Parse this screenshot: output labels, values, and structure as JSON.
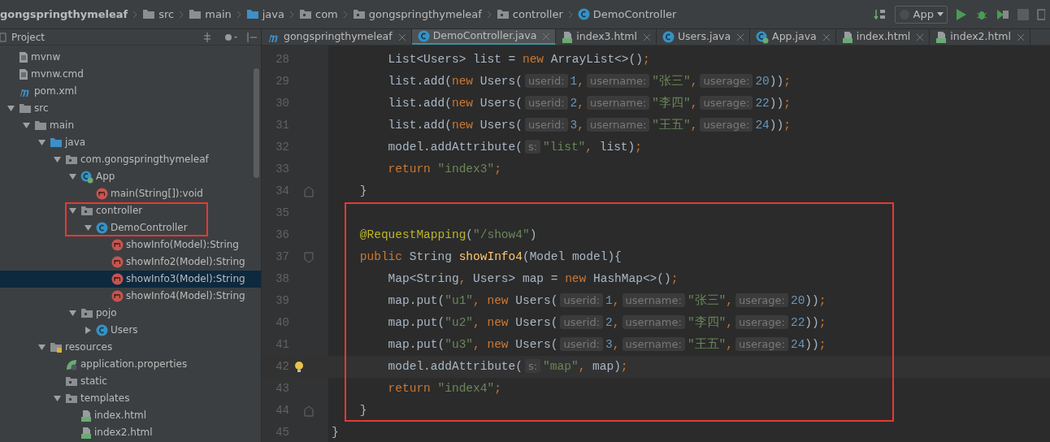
{
  "breadcrumb": [
    {
      "label": "gongspringthymeleaf"
    },
    {
      "label": "src",
      "kind": "folder"
    },
    {
      "label": "main",
      "kind": "folder"
    },
    {
      "label": "java",
      "kind": "source-folder"
    },
    {
      "label": "com",
      "kind": "package"
    },
    {
      "label": "gongspringthymeleaf",
      "kind": "package"
    },
    {
      "label": "controller",
      "kind": "package"
    },
    {
      "label": "DemoController",
      "kind": "class"
    }
  ],
  "run_config": {
    "label": "App"
  },
  "project_panel": {
    "title": "Project"
  },
  "tabs": [
    {
      "label": "gongspringthymeleaf",
      "kind": "maven",
      "selected": false
    },
    {
      "label": "DemoController.java",
      "kind": "class",
      "selected": true
    },
    {
      "label": "index3.html",
      "kind": "html",
      "selected": false
    },
    {
      "label": "Users.java",
      "kind": "class",
      "selected": false
    },
    {
      "label": "App.java",
      "kind": "app-class",
      "selected": false
    },
    {
      "label": "index.html",
      "kind": "html",
      "selected": false
    },
    {
      "label": "index2.html",
      "kind": "html",
      "selected": false
    }
  ],
  "tree": [
    {
      "label": "mvnw",
      "kind": "file",
      "selected": false
    },
    {
      "label": "mvnw.cmd",
      "kind": "file",
      "selected": false
    },
    {
      "label": "pom.xml",
      "kind": "maven",
      "selected": false
    },
    {
      "label": "src",
      "kind": "folder",
      "selected": false,
      "expanded": true,
      "children": [
        {
          "label": "main",
          "kind": "folder",
          "selected": false,
          "expanded": true,
          "children": [
            {
              "label": "java",
              "kind": "source-folder",
              "selected": false,
              "expanded": true,
              "children": [
                {
                  "label": "com.gongspringthymeleaf",
                  "kind": "package",
                  "selected": false,
                  "expanded": true,
                  "children": [
                    {
                      "label": "App",
                      "kind": "app-class",
                      "selected": false,
                      "expanded": true,
                      "children": [
                        {
                          "label": "main(String[]):void",
                          "kind": "method",
                          "selected": false
                        }
                      ]
                    },
                    {
                      "label": "controller",
                      "kind": "package",
                      "selected": false,
                      "expanded": true,
                      "outlined": true,
                      "children": [
                        {
                          "label": "DemoController",
                          "kind": "class",
                          "selected": false,
                          "expanded": true,
                          "outlined": true,
                          "children": [
                            {
                              "label": "showInfo(Model):String",
                              "kind": "method",
                              "selected": false
                            },
                            {
                              "label": "showInfo2(Model):String",
                              "kind": "method",
                              "selected": false
                            },
                            {
                              "label": "showInfo3(Model):String",
                              "kind": "method",
                              "selected": true
                            },
                            {
                              "label": "showInfo4(Model):String",
                              "kind": "method",
                              "selected": false
                            }
                          ]
                        }
                      ]
                    },
                    {
                      "label": "pojo",
                      "kind": "package",
                      "selected": false,
                      "expanded": true,
                      "children": [
                        {
                          "label": "Users",
                          "kind": "class",
                          "selected": false,
                          "expanded": false
                        }
                      ]
                    }
                  ]
                }
              ]
            },
            {
              "label": "resources",
              "kind": "resources-folder",
              "selected": false,
              "expanded": true,
              "children": [
                {
                  "label": "application.properties",
                  "kind": "properties",
                  "selected": false
                },
                {
                  "label": "static",
                  "kind": "package",
                  "selected": false
                },
                {
                  "label": "templates",
                  "kind": "package",
                  "selected": false,
                  "expanded": true,
                  "children": [
                    {
                      "label": "index.html",
                      "kind": "html",
                      "selected": false
                    },
                    {
                      "label": "index2.html",
                      "kind": "html",
                      "selected": false
                    }
                  ]
                }
              ]
            }
          ]
        }
      ]
    }
  ],
  "code": [
    {
      "number": "28",
      "outlined": false,
      "current": false,
      "tokens": [
        {
          "kind": "plain",
          "text": "        List<Users> list = "
        },
        {
          "kind": "keyword",
          "text": "new"
        },
        {
          "kind": "plain",
          "text": " ArrayList<>()"
        },
        {
          "kind": "keyword",
          "text": ";"
        }
      ]
    },
    {
      "number": "29",
      "outlined": false,
      "current": false,
      "tokens": [
        {
          "kind": "plain",
          "text": "        list.add("
        },
        {
          "kind": "keyword",
          "text": "new"
        },
        {
          "kind": "plain",
          "text": " Users("
        },
        {
          "kind": "hint",
          "text": "userid:"
        },
        {
          "kind": "number",
          "text": "1"
        },
        {
          "kind": "keyword",
          "text": ","
        },
        {
          "kind": "hint",
          "text": "username:"
        },
        {
          "kind": "string",
          "text": "\"张三\""
        },
        {
          "kind": "keyword",
          "text": ","
        },
        {
          "kind": "hint",
          "text": "userage:"
        },
        {
          "kind": "number",
          "text": "20"
        },
        {
          "kind": "plain",
          "text": "))"
        },
        {
          "kind": "keyword",
          "text": ";"
        }
      ]
    },
    {
      "number": "30",
      "outlined": false,
      "current": false,
      "tokens": [
        {
          "kind": "plain",
          "text": "        list.add("
        },
        {
          "kind": "keyword",
          "text": "new"
        },
        {
          "kind": "plain",
          "text": " Users("
        },
        {
          "kind": "hint",
          "text": "userid:"
        },
        {
          "kind": "number",
          "text": "2"
        },
        {
          "kind": "keyword",
          "text": ","
        },
        {
          "kind": "hint",
          "text": "username:"
        },
        {
          "kind": "string",
          "text": "\"李四\""
        },
        {
          "kind": "keyword",
          "text": ","
        },
        {
          "kind": "hint",
          "text": "userage:"
        },
        {
          "kind": "number",
          "text": "22"
        },
        {
          "kind": "plain",
          "text": "))"
        },
        {
          "kind": "keyword",
          "text": ";"
        }
      ]
    },
    {
      "number": "31",
      "outlined": false,
      "current": false,
      "tokens": [
        {
          "kind": "plain",
          "text": "        list.add("
        },
        {
          "kind": "keyword",
          "text": "new"
        },
        {
          "kind": "plain",
          "text": " Users("
        },
        {
          "kind": "hint",
          "text": "userid:"
        },
        {
          "kind": "number",
          "text": "3"
        },
        {
          "kind": "keyword",
          "text": ","
        },
        {
          "kind": "hint",
          "text": "username:"
        },
        {
          "kind": "string",
          "text": "\"王五\""
        },
        {
          "kind": "keyword",
          "text": ","
        },
        {
          "kind": "hint",
          "text": "userage:"
        },
        {
          "kind": "number",
          "text": "24"
        },
        {
          "kind": "plain",
          "text": "))"
        },
        {
          "kind": "keyword",
          "text": ";"
        }
      ]
    },
    {
      "number": "32",
      "outlined": false,
      "current": false,
      "tokens": [
        {
          "kind": "plain",
          "text": "        model.addAttribute("
        },
        {
          "kind": "hint",
          "text": "s:"
        },
        {
          "kind": "string",
          "text": "\"list\""
        },
        {
          "kind": "keyword",
          "text": ","
        },
        {
          "kind": "plain",
          "text": " list)"
        },
        {
          "kind": "keyword",
          "text": ";"
        }
      ]
    },
    {
      "number": "33",
      "outlined": false,
      "current": false,
      "tokens": [
        {
          "kind": "keyword",
          "text": "        return"
        },
        {
          "kind": "string",
          "text": " \"index3\""
        },
        {
          "kind": "keyword",
          "text": ";"
        }
      ]
    },
    {
      "number": "34",
      "outlined": false,
      "current": false,
      "tokens": [
        {
          "kind": "plain",
          "text": "    }"
        }
      ]
    },
    {
      "number": "35",
      "outlined": true,
      "current": false
    },
    {
      "number": "36",
      "outlined": true,
      "current": false,
      "tokens": [
        {
          "kind": "annotation",
          "text": "    @RequestMapping"
        },
        {
          "kind": "plain",
          "text": "("
        },
        {
          "kind": "string",
          "text": "\"/show4\""
        },
        {
          "kind": "plain",
          "text": ")"
        }
      ]
    },
    {
      "number": "37",
      "outlined": true,
      "current": false,
      "tokens": [
        {
          "kind": "keyword",
          "text": "    public"
        },
        {
          "kind": "plain",
          "text": " String "
        },
        {
          "kind": "method",
          "text": "showInfo4"
        },
        {
          "kind": "plain",
          "text": "(Model model){"
        }
      ]
    },
    {
      "number": "38",
      "outlined": true,
      "current": false,
      "tokens": [
        {
          "kind": "plain",
          "text": "        Map<String"
        },
        {
          "kind": "keyword",
          "text": ","
        },
        {
          "kind": "plain",
          "text": " Users> map = "
        },
        {
          "kind": "keyword",
          "text": "new"
        },
        {
          "kind": "plain",
          "text": " HashMap<>()"
        },
        {
          "kind": "keyword",
          "text": ";"
        }
      ]
    },
    {
      "number": "39",
      "outlined": true,
      "current": false,
      "tokens": [
        {
          "kind": "plain",
          "text": "        map.put("
        },
        {
          "kind": "string",
          "text": "\"u1\""
        },
        {
          "kind": "keyword",
          "text": ", new"
        },
        {
          "kind": "plain",
          "text": " Users("
        },
        {
          "kind": "hint",
          "text": "userid:"
        },
        {
          "kind": "number",
          "text": "1"
        },
        {
          "kind": "keyword",
          "text": ","
        },
        {
          "kind": "hint",
          "text": "username:"
        },
        {
          "kind": "string",
          "text": "\"张三\""
        },
        {
          "kind": "keyword",
          "text": ","
        },
        {
          "kind": "hint",
          "text": "userage:"
        },
        {
          "kind": "number",
          "text": "20"
        },
        {
          "kind": "plain",
          "text": "))"
        },
        {
          "kind": "keyword",
          "text": ";"
        }
      ]
    },
    {
      "number": "40",
      "outlined": true,
      "current": false,
      "tokens": [
        {
          "kind": "plain",
          "text": "        map.put("
        },
        {
          "kind": "string",
          "text": "\"u2\""
        },
        {
          "kind": "keyword",
          "text": ", new"
        },
        {
          "kind": "plain",
          "text": " Users("
        },
        {
          "kind": "hint",
          "text": "userid:"
        },
        {
          "kind": "number",
          "text": "2"
        },
        {
          "kind": "keyword",
          "text": ","
        },
        {
          "kind": "hint",
          "text": "username:"
        },
        {
          "kind": "string",
          "text": "\"李四\""
        },
        {
          "kind": "keyword",
          "text": ","
        },
        {
          "kind": "hint",
          "text": "userage:"
        },
        {
          "kind": "number",
          "text": "22"
        },
        {
          "kind": "plain",
          "text": "))"
        },
        {
          "kind": "keyword",
          "text": ";"
        }
      ]
    },
    {
      "number": "41",
      "outlined": true,
      "current": false,
      "tokens": [
        {
          "kind": "plain",
          "text": "        map.put("
        },
        {
          "kind": "string",
          "text": "\"u3\""
        },
        {
          "kind": "keyword",
          "text": ", new"
        },
        {
          "kind": "plain",
          "text": " Users("
        },
        {
          "kind": "hint",
          "text": "userid:"
        },
        {
          "kind": "number",
          "text": "3"
        },
        {
          "kind": "keyword",
          "text": ","
        },
        {
          "kind": "hint",
          "text": "username:"
        },
        {
          "kind": "string",
          "text": "\"王五\""
        },
        {
          "kind": "keyword",
          "text": ","
        },
        {
          "kind": "hint",
          "text": "userage:"
        },
        {
          "kind": "number",
          "text": "24"
        },
        {
          "kind": "plain",
          "text": "))"
        },
        {
          "kind": "keyword",
          "text": ";"
        }
      ]
    },
    {
      "number": "42",
      "outlined": true,
      "current": true,
      "tokens": [
        {
          "kind": "plain",
          "text": "        model.addAttribute("
        },
        {
          "kind": "hint",
          "text": "s:"
        },
        {
          "kind": "string",
          "text": "\"map\""
        },
        {
          "kind": "keyword",
          "text": ","
        },
        {
          "kind": "plain",
          "text": " map)"
        },
        {
          "kind": "keyword",
          "text": ";"
        }
      ]
    },
    {
      "number": "43",
      "outlined": true,
      "current": false,
      "tokens": [
        {
          "kind": "keyword",
          "text": "        return"
        },
        {
          "kind": "string",
          "text": " \"index4\""
        },
        {
          "kind": "keyword",
          "text": ";"
        }
      ]
    },
    {
      "number": "44",
      "outlined": true,
      "current": false,
      "tokens": [
        {
          "kind": "plain",
          "text": "    }"
        }
      ]
    },
    {
      "number": "45",
      "outlined": false,
      "current": false,
      "tokens": [
        {
          "kind": "plain",
          "text": "}"
        }
      ]
    }
  ]
}
